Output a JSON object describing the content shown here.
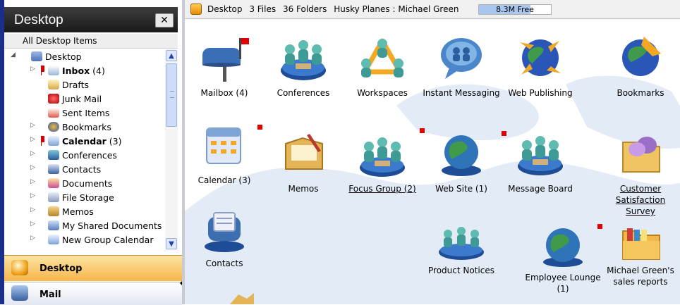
{
  "sidebar": {
    "title": "Desktop",
    "close_label": "✕",
    "all_items": "All Desktop Items",
    "tree": [
      {
        "label": "Desktop",
        "icon": "desktop-icon",
        "expand": "◢",
        "level": 0
      },
      {
        "label": "Inbox",
        "count": " (4)",
        "bold": true,
        "icon": "inbox-icon",
        "expand": "▷",
        "flag": true,
        "level": 1
      },
      {
        "label": "Drafts",
        "icon": "drafts-icon",
        "level": 1
      },
      {
        "label": "Junk Mail",
        "icon": "junk-mail-icon",
        "level": 1
      },
      {
        "label": "Sent Items",
        "icon": "sent-items-icon",
        "level": 1
      },
      {
        "label": "Bookmarks",
        "icon": "bookmarks-icon",
        "expand": "▷",
        "level": 1
      },
      {
        "label": "Calendar",
        "count": " (3)",
        "bold": true,
        "icon": "calendar-icon",
        "expand": "▷",
        "flag": true,
        "level": 1
      },
      {
        "label": "Conferences",
        "icon": "conferences-icon",
        "expand": "▷",
        "level": 1
      },
      {
        "label": "Contacts",
        "icon": "contacts-icon",
        "expand": "▷",
        "level": 1
      },
      {
        "label": "Documents",
        "icon": "documents-icon",
        "expand": "▷",
        "level": 1
      },
      {
        "label": "File Storage",
        "icon": "file-storage-icon",
        "expand": "▷",
        "level": 1
      },
      {
        "label": "Memos",
        "icon": "memos-icon",
        "expand": "▷",
        "level": 1
      },
      {
        "label": "My Shared Documents",
        "icon": "shared-documents-icon",
        "expand": "▷",
        "level": 1
      },
      {
        "label": "New Group Calendar",
        "icon": "group-calendar-icon",
        "expand": "▷",
        "level": 1
      }
    ],
    "nav_desktop": "Desktop",
    "nav_mail": "Mail"
  },
  "topbar": {
    "location": "Desktop",
    "files": "3 Files",
    "folders": "36 Folders",
    "account": "Husky Planes : Michael Green",
    "free_space": "8.3M Free",
    "free_fraction": 0.72
  },
  "tiles": [
    {
      "label": "Mailbox (4)",
      "icon": "mailbox-icon",
      "flag": true
    },
    {
      "label": "Conferences",
      "icon": "conferences-icon"
    },
    {
      "label": "Workspaces",
      "icon": "workspaces-icon"
    },
    {
      "label": "Instant Messaging",
      "icon": "instant-messaging-icon"
    },
    {
      "label": "Web Publishing",
      "icon": "web-publishing-icon"
    },
    {
      "label": "Bookmarks",
      "icon": "bookmarks-icon"
    },
    {
      "label": "Calendar (3)",
      "icon": "calendar-icon",
      "flag": true
    },
    {
      "label": "Memos",
      "icon": "memos-icon"
    },
    {
      "label": "Focus Group (2)",
      "icon": "focus-group-icon",
      "flag": true,
      "underline": true
    },
    {
      "label": "Web Site (1)",
      "icon": "web-site-icon",
      "flag": true
    },
    {
      "label": "Message Board",
      "icon": "message-board-icon"
    },
    {
      "label": "Customer Satisfaction Survey",
      "icon": "survey-icon",
      "underline": true
    },
    {
      "label": "Contacts",
      "icon": "contacts-icon"
    },
    {
      "label": "Product Notices",
      "icon": "product-notices-icon"
    },
    {
      "label": "Employee Lounge (1)",
      "icon": "employee-lounge-icon",
      "flag": true
    },
    {
      "label": "Michael Green's sales reports",
      "icon": "sales-reports-folder-icon"
    }
  ],
  "colors": {
    "nav_desktop": "#f6b54a",
    "scroll": "#9db3e6",
    "flag": "#e00000"
  }
}
